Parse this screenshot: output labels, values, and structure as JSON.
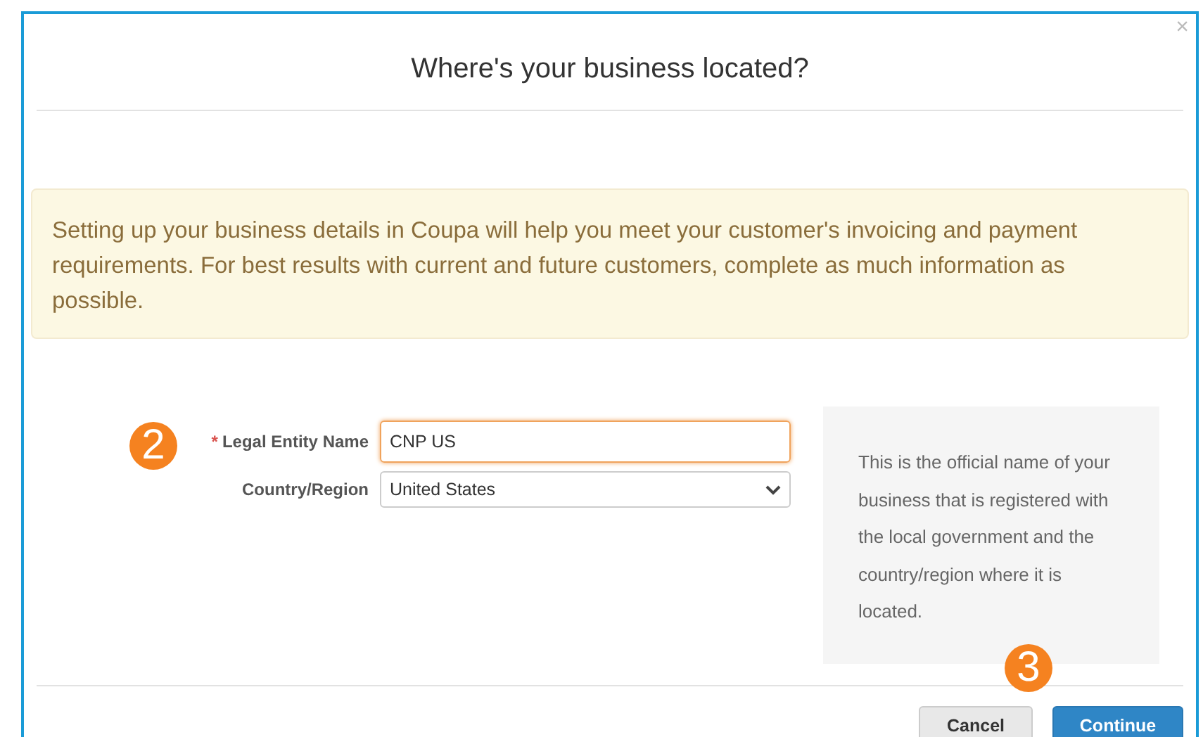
{
  "dialog": {
    "title": "Where's your business located?",
    "close": "×"
  },
  "notice": "Setting up your business details in Coupa will help you meet your customer's invoicing and payment requirements. For best results with current and future customers, complete as much information as possible.",
  "form": {
    "step": "2",
    "fields": [
      {
        "kind": "text",
        "required_mark": "*",
        "label": "Legal Entity Name",
        "focused": true,
        "value": "CNP US"
      },
      {
        "kind": "select",
        "label": "Country/Region",
        "focused": false,
        "value": "United States"
      }
    ]
  },
  "help": "This is the official name of your business that is registered with the local government and the country/region where it is located.",
  "footer": {
    "step": "3",
    "buttons": [
      {
        "label": "Cancel",
        "kind": "secondary"
      },
      {
        "label": "Continue",
        "kind": "primary"
      }
    ]
  }
}
